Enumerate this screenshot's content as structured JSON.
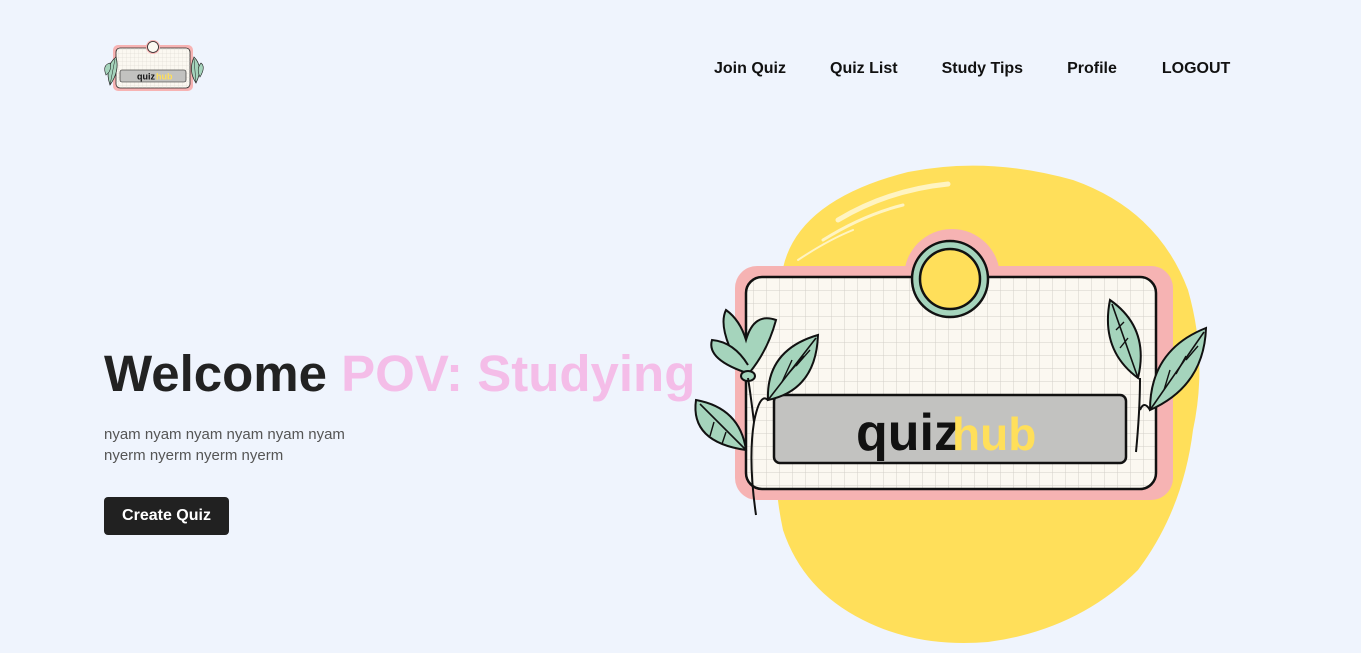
{
  "logo": {
    "word_quiz": "quiz",
    "word_hub": "hub"
  },
  "nav": {
    "items": [
      {
        "label": "Join Quiz"
      },
      {
        "label": "Quiz List"
      },
      {
        "label": "Study Tips"
      },
      {
        "label": "Profile"
      },
      {
        "label": "LOGOUT"
      }
    ]
  },
  "hero": {
    "title_main": "Welcome",
    "title_accent": "POV: Studying",
    "description_line1": "nyam nyam nyam nyam nyam nyam",
    "description_line2": "nyerm nyerm nyerm nyerm",
    "cta_label": "Create Quiz"
  },
  "illustration": {
    "word_quiz": "quiz",
    "word_hub": "hub"
  },
  "colors": {
    "background": "#eff4fd",
    "accent_pink": "#f4bde8",
    "button_bg": "#212121",
    "yellow": "#ffdf5a",
    "leaf_green": "#a5d4bc",
    "frame_pink": "#f6b3b3"
  }
}
